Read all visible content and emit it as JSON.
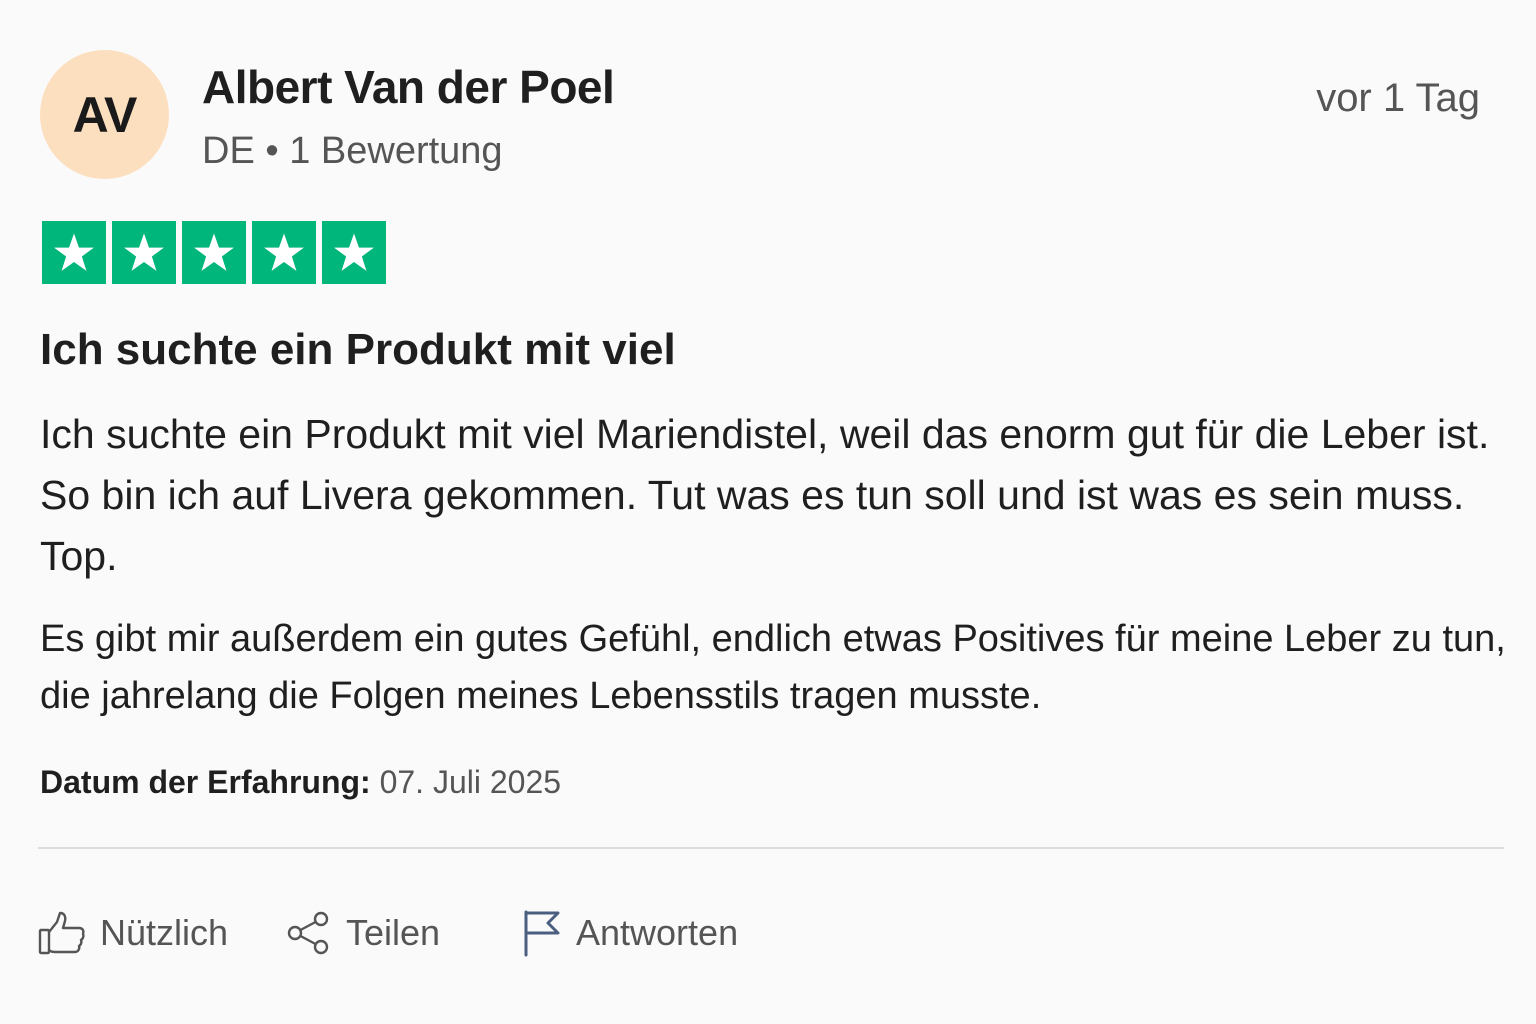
{
  "reviewer": {
    "initials": "AV",
    "name": "Albert Van der Poel",
    "meta": "DE • 1 Bewertung"
  },
  "review_time": "vor 1 Tag",
  "rating": {
    "value": 5,
    "max": 5,
    "color": "#00b67a",
    "icon": "star-icon"
  },
  "review": {
    "title": "Ich suchte ein Produkt mit viel",
    "body_paragraph_1": "Ich suchte ein Produkt mit viel Mariendistel, weil  das enorm gut für die Leber ist. So bin ich auf Livera gekommen. Tut was es tun soll und ist was es sein muss. Top.",
    "body_paragraph_2": "Es gibt mir außerdem ein gutes Gefühl, endlich etwas Positives für meine Leber zu tun, die jahrelang die Folgen meines Lebensstils tragen musste.",
    "experience_date_label": "Datum der Erfahrung:",
    "experience_date_value": "07. Juli 2025"
  },
  "actions": {
    "helpful_label": "Nützlich",
    "helpful_icon": "thumbs-up-icon",
    "share_label": "Teilen",
    "share_icon": "share-icon",
    "reply_label": "Antworten",
    "reply_icon": "flag-icon"
  },
  "colors": {
    "avatar_bg": "#fcdfbf",
    "star_green": "#00b67a",
    "text_primary": "#1f1f1f",
    "text_secondary": "#555555",
    "flag_icon": "#4a5f80"
  }
}
